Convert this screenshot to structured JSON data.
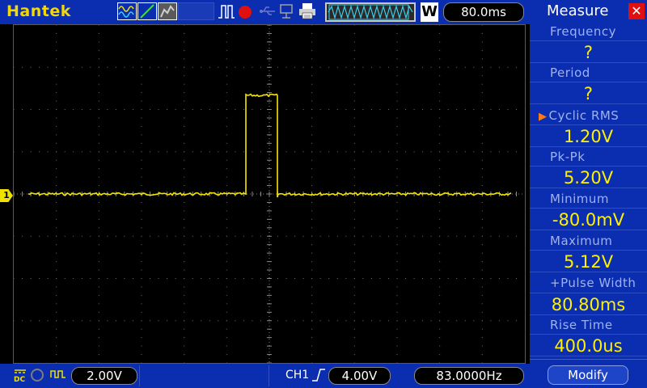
{
  "header": {
    "brand": "Hantek",
    "timebase": "80.0ms",
    "mode_badge": "W"
  },
  "icons": {
    "waveform": "sine-wave-icon",
    "ramp": "ramp-icon",
    "persist": "persistence-icon",
    "trigger": "pulse-trigger-icon",
    "run_state": "run-stop-icon",
    "usb": "usb-icon",
    "lan": "lan-icon",
    "printer": "printer-icon"
  },
  "channel": {
    "marker": "1",
    "scale": "2.00V",
    "color": "#f0e000"
  },
  "trigger": {
    "source": "CH1",
    "level": "4.00V"
  },
  "counter": {
    "frequency": "83.0000Hz"
  },
  "measure": {
    "title": "Measure",
    "items": [
      {
        "label": "Frequency",
        "value": "?"
      },
      {
        "label": "Period",
        "value": "?"
      },
      {
        "label": "Cyclic RMS",
        "value": "1.20V",
        "selected": true
      },
      {
        "label": "Pk-Pk",
        "value": "5.20V"
      },
      {
        "label": "Minimum",
        "value": "-80.0mV"
      },
      {
        "label": "Maximum",
        "value": "5.12V"
      },
      {
        "label": "+Pulse Width",
        "value": "80.80ms"
      },
      {
        "label": "Rise Time",
        "value": "400.0us"
      }
    ],
    "modify_label": "Modify"
  },
  "colors": {
    "bar_bg": "#0b2db0",
    "trace": "#f5e600",
    "value_text": "#fff000",
    "grid_dots": "#6e6e6e"
  }
}
